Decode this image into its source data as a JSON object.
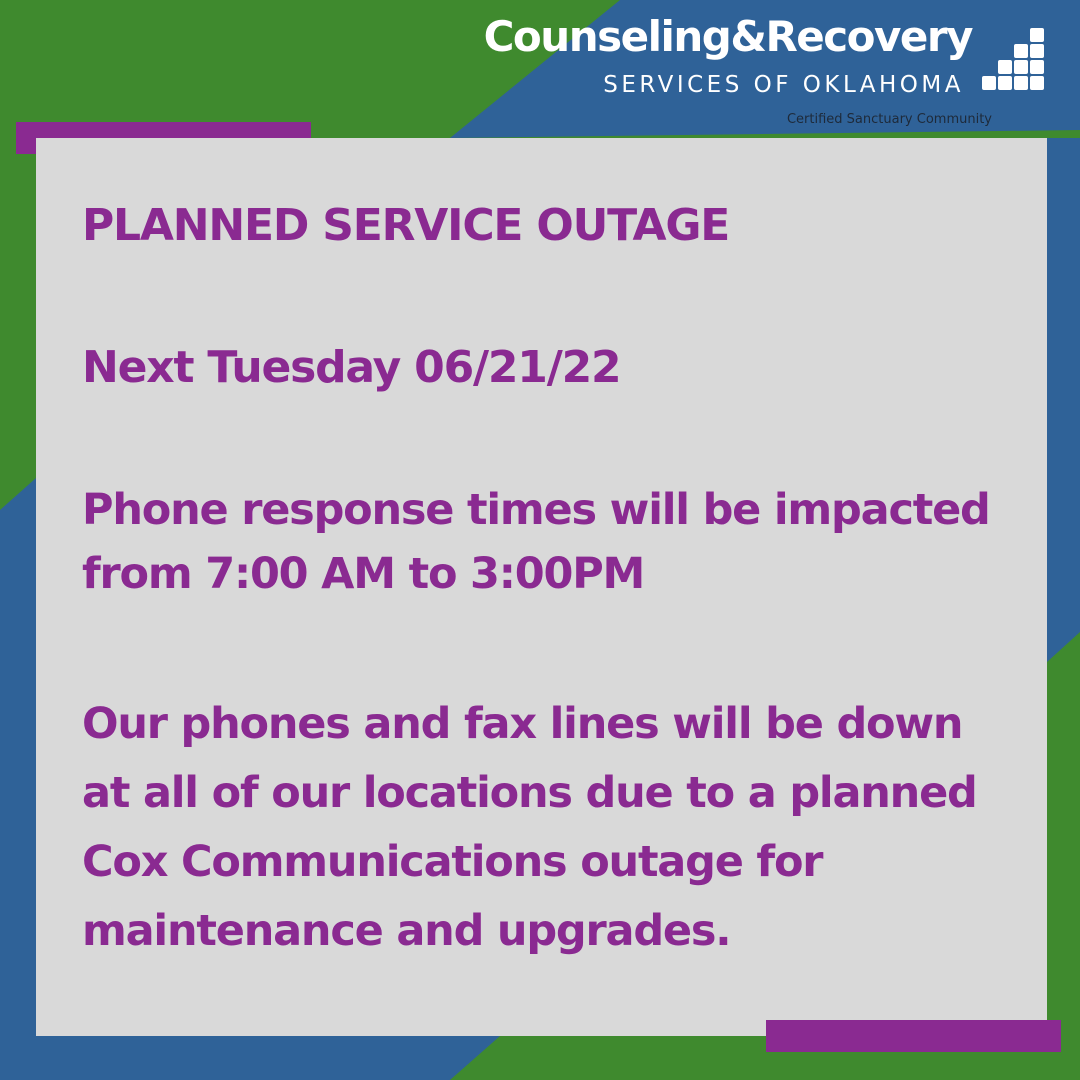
{
  "brand": {
    "name": "Counseling&Recovery",
    "subtitle": "SERVICES OF OKLAHOMA",
    "tagline": "Certified Sanctuary Community",
    "mark_icon": "stacked-blocks-logo-icon"
  },
  "notice": {
    "headline": "PLANNED SERVICE OUTAGE",
    "date": "Next Tuesday 06/21/22",
    "impact_lines": [
      "Phone response times will be impacted",
      "from 7:00 AM to 3:00PM"
    ],
    "detail_lines": [
      "Our phones and fax lines will be down",
      "at all of our locations due to a planned",
      "Cox Communications outage for",
      "maintenance and upgrades."
    ]
  },
  "colors": {
    "green": "#3f8a2e",
    "blue": "#2f6298",
    "purple": "#8a2a91",
    "panel": "#d9d9d9",
    "white": "#ffffff"
  }
}
